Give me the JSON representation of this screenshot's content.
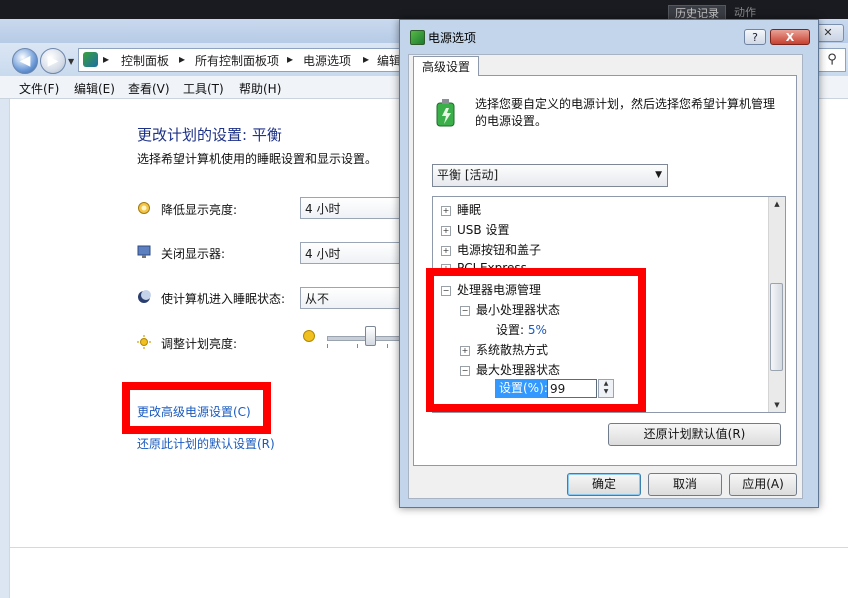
{
  "top_tabs": [
    "历史记录",
    "动作"
  ],
  "control_panel": {
    "breadcrumbs": [
      "控制面板",
      "所有控制面板项",
      "电源选项",
      "编辑"
    ],
    "menu": [
      "文件(F)",
      "编辑(E)",
      "查看(V)",
      "工具(T)",
      "帮助(H)"
    ],
    "heading": "更改计划的设置: 平衡",
    "subheading": "选择希望计算机使用的睡眠设置和显示设置。",
    "settings": [
      {
        "label": "降低显示亮度:",
        "value": "4 小时",
        "icon": "dim-display-icon"
      },
      {
        "label": "关闭显示器:",
        "value": "4 小时",
        "icon": "monitor-off-icon"
      },
      {
        "label": "使计算机进入睡眠状态:",
        "value": "从不",
        "icon": "sleep-moon-icon"
      },
      {
        "label": "调整计划亮度:",
        "icon": "brightness-sun-icon"
      }
    ],
    "link_advanced": "更改高级电源设置(C)",
    "link_restore": "还原此计划的默认设置(R)"
  },
  "dialog": {
    "title": "电源选项",
    "help_button": "?",
    "close_button": "X",
    "tab": "高级设置",
    "description": "选择您要自定义的电源计划，然后选择您希望计算机管理的电源设置。",
    "plan_select": "平衡 [活动]",
    "tree": {
      "sleep": "睡眠",
      "usb": "USB 设置",
      "power_buttons": "电源按钮和盖子",
      "pci": "PCI Express",
      "processor": "处理器电源管理",
      "min_state": "最小处理器状态",
      "min_setting_label": "设置:",
      "min_setting_value": "5%",
      "cooling": "系统散热方式",
      "max_state": "最大处理器状态",
      "max_setting_label": "设置(%):",
      "max_setting_value": "99"
    },
    "restore_button": "还原计划默认值(R)",
    "ok_button": "确定",
    "cancel_button": "取消",
    "apply_button": "应用(A)"
  },
  "colors": {
    "highlight_red": "#ff0000",
    "link_blue": "#1a5bbf",
    "heading_blue": "#1e3287",
    "selection_blue": "#3399ff"
  }
}
